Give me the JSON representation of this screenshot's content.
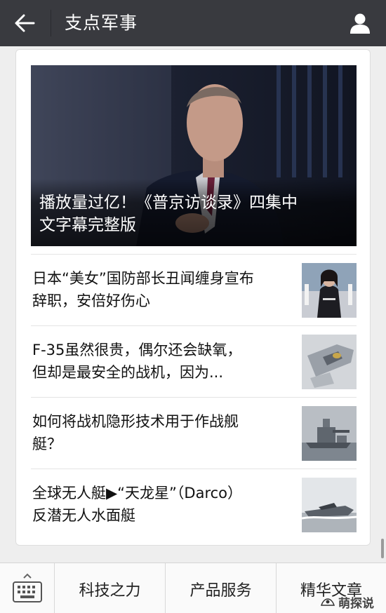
{
  "header": {
    "title": "支点军事",
    "back_icon": "arrow-left-icon",
    "profile_icon": "person-icon"
  },
  "hero": {
    "title_line1": "播放量过亿！《普京访谈录》四集中",
    "title_line2": "文字幕完整版"
  },
  "articles": [
    {
      "line1": "日本“美女”国防部长丑闻缠身宣布",
      "line2": "辞职，安倍好伤心"
    },
    {
      "line1": "F-35虽然很贵，偶尔还会缺氧，",
      "line2": "但却是最安全的战机，因为..."
    },
    {
      "line1": "如何将战机隐形技术用于作战舰",
      "line2": "艇？"
    },
    {
      "line1": "全球无人艇▶“天龙星”（Darco）",
      "line2": "反潜无人水面艇"
    }
  ],
  "bottom_menu": {
    "keyboard_icon": "keyboard-icon",
    "items": [
      "科技之力",
      "产品服务",
      "精华文章"
    ]
  },
  "watermark": {
    "text": "萌探说"
  },
  "colors": {
    "navbar": "#393a3f",
    "background": "#eeeeee",
    "card": "#ffffff"
  }
}
